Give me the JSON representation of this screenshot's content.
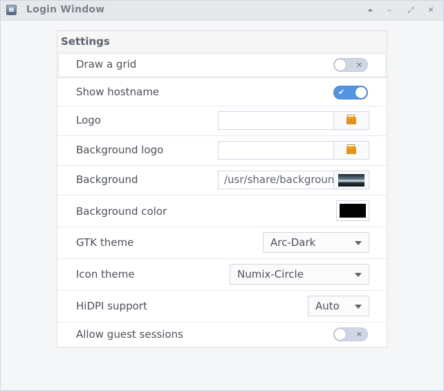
{
  "window": {
    "title": "Login Window",
    "controls": [
      "upload-icon",
      "minimize-icon",
      "restore-icon",
      "close-icon"
    ]
  },
  "settings": {
    "header": "Settings",
    "draw_grid": {
      "label": "Draw a grid",
      "enabled": false,
      "off_mark": "×"
    },
    "show_hostname": {
      "label": "Show hostname",
      "enabled": true,
      "on_mark": "✔"
    },
    "logo": {
      "label": "Logo",
      "value": ""
    },
    "background_logo": {
      "label": "Background logo",
      "value": ""
    },
    "background": {
      "label": "Background",
      "value": "/usr/share/backgroun"
    },
    "background_color": {
      "label": "Background color",
      "color": "#000000"
    },
    "gtk_theme": {
      "label": "GTK theme",
      "selected": "Arc-Dark"
    },
    "icon_theme": {
      "label": "Icon theme",
      "selected": "Numix-Circle"
    },
    "hidpi": {
      "label": "HiDPI support",
      "selected": "Auto"
    },
    "guest_sessions": {
      "label": "Allow guest sessions",
      "enabled": false,
      "off_mark": "×"
    }
  },
  "colors": {
    "accent": "#5294e2",
    "switch_off": "#cfd6e6",
    "text": "#5c616c",
    "folder": "#f5a623"
  }
}
